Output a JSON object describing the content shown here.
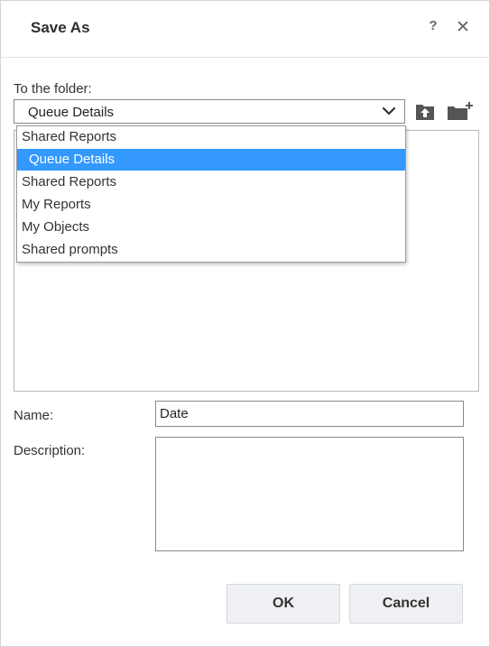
{
  "dialog": {
    "title": "Save As",
    "help_label": "?",
    "close_label": "✕"
  },
  "folder": {
    "label": "To the folder:",
    "selected": "Queue Details",
    "up_icon": "folder-up-icon",
    "new_icon": "new-folder-icon"
  },
  "dropdown": {
    "items": [
      {
        "label": "Shared Reports",
        "selected": false
      },
      {
        "label": "Queue Details",
        "selected": true
      },
      {
        "label": "Shared Reports",
        "selected": false
      },
      {
        "label": "My Reports",
        "selected": false
      },
      {
        "label": "My Objects",
        "selected": false
      },
      {
        "label": "Shared prompts",
        "selected": false
      }
    ]
  },
  "name": {
    "label": "Name:",
    "value": "Date"
  },
  "description": {
    "label": "Description:",
    "value": ""
  },
  "buttons": {
    "ok": "OK",
    "cancel": "Cancel"
  },
  "colors": {
    "selection": "#3399ff",
    "button_bg": "#eef0f3",
    "icon": "#555555"
  }
}
